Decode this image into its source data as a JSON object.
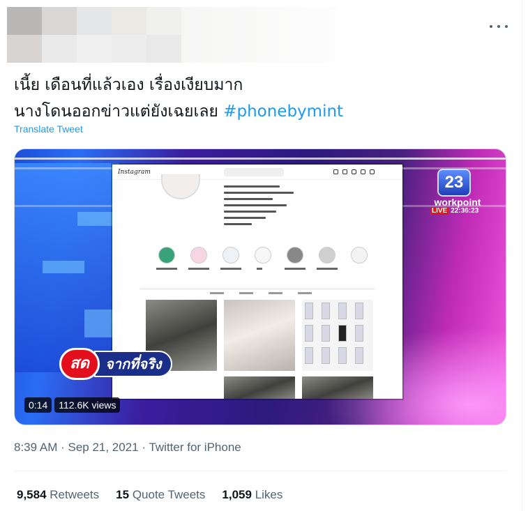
{
  "header": {
    "more_icon": "more-horizontal-icon",
    "mosaic_colors": [
      "#b9b8b7",
      "#d8d7d5",
      "#e6e7e9",
      "#ebe9e4",
      "#f0f0ee",
      "#d8d4d1",
      "#e9e9e9",
      "#f0f0f0",
      "#ededed",
      "#e9e9e9"
    ]
  },
  "tweet": {
    "line1": "เนี้ย เดือนที่แล้วเอง เรื่องเงียบมาก",
    "line2": "นางโดนออกข่าวแต่ยังเฉยเลย ",
    "hashtag": "#phonebymint",
    "translate_label": "Translate Tweet"
  },
  "video": {
    "duration": "0:14",
    "views": "112.6K views",
    "overlay": {
      "sod_label": "สด",
      "banner_label": "จากที่จริง",
      "channel_number": "23",
      "channel_name": "workpoint",
      "live_label": "LIVE",
      "live_time": "22:36:23",
      "app_name": "Instagram"
    }
  },
  "meta": {
    "time": "8:39 AM",
    "separator": " · ",
    "date": "Sep 21, 2021",
    "source": "Twitter for iPhone"
  },
  "stats": {
    "retweets_count": "9,584",
    "retweets_label": "Retweets",
    "quotes_count": "15",
    "quotes_label": "Quote Tweets",
    "likes_count": "1,059",
    "likes_label": "Likes"
  },
  "colors": {
    "accent": "#1d9bf0",
    "text": "#0f1419",
    "secondary": "#536471"
  }
}
